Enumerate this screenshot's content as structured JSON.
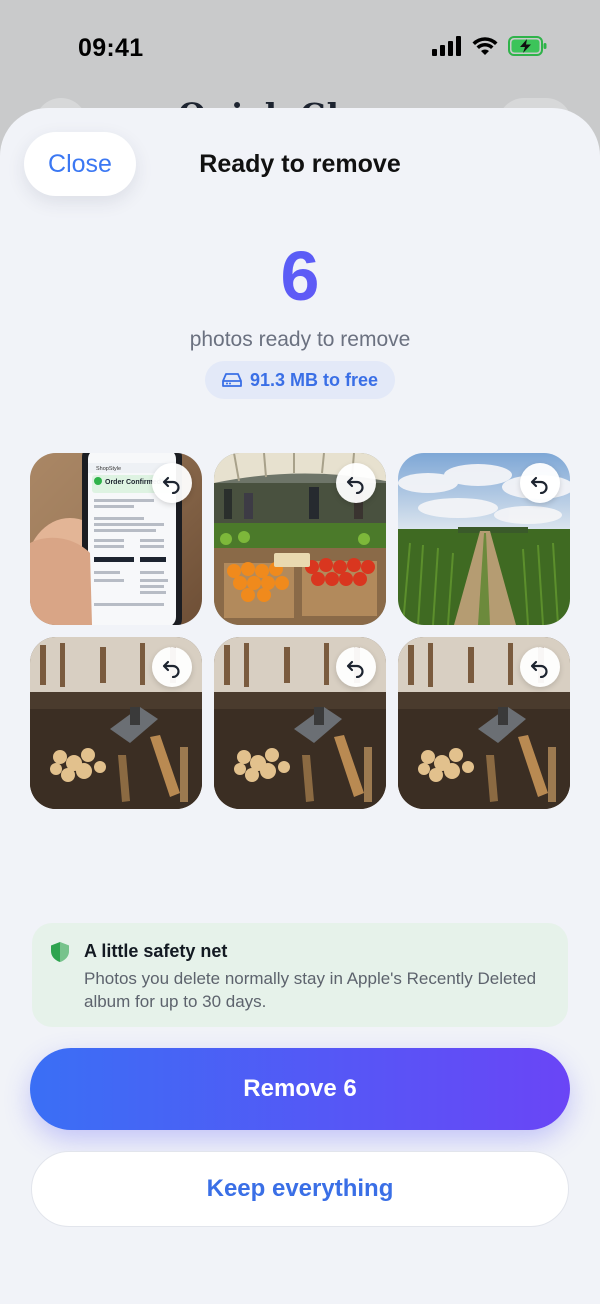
{
  "status_bar": {
    "time": "09:41"
  },
  "background_app": {
    "title": "Quick Clean"
  },
  "sheet": {
    "close_label": "Close",
    "title": "Ready to remove",
    "count": "6",
    "subtitle": "photos ready to remove",
    "size_free": "91.3 MB to free"
  },
  "photos": [
    {
      "name": "phone-receipt-photo",
      "screen_heading": "Order Confirmed!",
      "brand": "ShopStyle"
    },
    {
      "name": "market-produce-photo"
    },
    {
      "name": "cornfield-path-photo"
    },
    {
      "name": "workbench-tools-photo-1"
    },
    {
      "name": "workbench-tools-photo-2"
    },
    {
      "name": "workbench-tools-photo-3"
    }
  ],
  "safety_card": {
    "title": "A little safety net",
    "body": "Photos you delete normally stay in Apple's Recently Deleted album for up to 30 days."
  },
  "actions": {
    "remove_label": "Remove 6",
    "keep_label": "Keep everything"
  },
  "colors": {
    "accent_blue": "#3a6ff5",
    "accent_purple": "#6a45f6",
    "safety_bg": "#e6f2ea",
    "shield_green": "#2ea44f"
  }
}
